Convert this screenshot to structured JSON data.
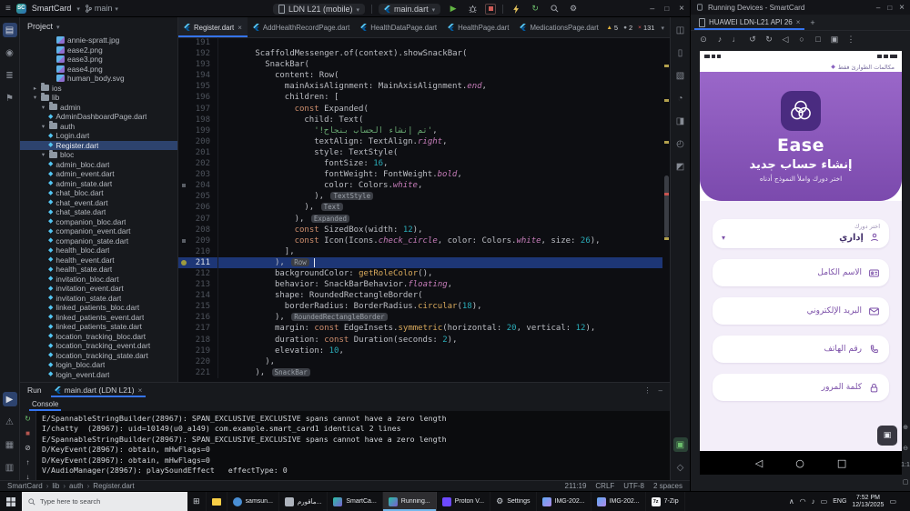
{
  "ide": {
    "titlebar": {
      "project_abbrev": "SC",
      "project_name": "SmartCard",
      "branch": "main",
      "device_selector": "LDN L21 (mobile)",
      "run_config": "main.dart"
    },
    "left_strip": [
      "project",
      "commit",
      "structure",
      "bookmarks"
    ],
    "left_strip_bottom": [
      "run",
      "problems",
      "terminal",
      "services"
    ],
    "left_strip_active": "project",
    "right_strip": [
      "notifications",
      "device-manager",
      "gradle",
      "ai",
      "build",
      "profiler",
      "emulator"
    ],
    "right_strip_bottom": [
      "running-devices",
      "gemini"
    ],
    "right_strip_active": "running-devices",
    "project": {
      "header": "Project",
      "items": [
        {
          "label": "annie-spratt.jpg",
          "icon": "image",
          "ind": 4
        },
        {
          "label": "ease2.png",
          "icon": "image",
          "ind": 4
        },
        {
          "label": "ease3.png",
          "icon": "image",
          "ind": 4
        },
        {
          "label": "ease4.png",
          "icon": "image",
          "ind": 4
        },
        {
          "label": "human_body.svg",
          "icon": "image",
          "ind": 4
        },
        {
          "label": "ios",
          "icon": "folder",
          "ind": 1,
          "chev": "closed"
        },
        {
          "label": "lib",
          "icon": "folder",
          "ind": 1,
          "chev": "open"
        },
        {
          "label": "admin",
          "icon": "folder",
          "ind": 2,
          "chev": "open"
        },
        {
          "label": "AdminDashboardPage.dart",
          "icon": "dart",
          "ind": 3
        },
        {
          "label": "auth",
          "icon": "folder",
          "ind": 2,
          "chev": "open"
        },
        {
          "label": "Login.dart",
          "icon": "dart",
          "ind": 3
        },
        {
          "label": "Register.dart",
          "icon": "dart",
          "ind": 3,
          "selected": true
        },
        {
          "label": "bloc",
          "icon": "folder",
          "ind": 2,
          "chev": "open"
        },
        {
          "label": "admin_bloc.dart",
          "icon": "dart",
          "ind": 3
        },
        {
          "label": "admin_event.dart",
          "icon": "dart",
          "ind": 3
        },
        {
          "label": "admin_state.dart",
          "icon": "dart",
          "ind": 3
        },
        {
          "label": "chat_bloc.dart",
          "icon": "dart",
          "ind": 3
        },
        {
          "label": "chat_event.dart",
          "icon": "dart",
          "ind": 3
        },
        {
          "label": "chat_state.dart",
          "icon": "dart",
          "ind": 3
        },
        {
          "label": "companion_bloc.dart",
          "icon": "dart",
          "ind": 3
        },
        {
          "label": "companion_event.dart",
          "icon": "dart",
          "ind": 3
        },
        {
          "label": "companion_state.dart",
          "icon": "dart",
          "ind": 3
        },
        {
          "label": "health_bloc.dart",
          "icon": "dart",
          "ind": 3
        },
        {
          "label": "health_event.dart",
          "icon": "dart",
          "ind": 3
        },
        {
          "label": "health_state.dart",
          "icon": "dart",
          "ind": 3
        },
        {
          "label": "invitation_bloc.dart",
          "icon": "dart",
          "ind": 3
        },
        {
          "label": "invitation_event.dart",
          "icon": "dart",
          "ind": 3
        },
        {
          "label": "invitation_state.dart",
          "icon": "dart",
          "ind": 3
        },
        {
          "label": "linked_patients_bloc.dart",
          "icon": "dart",
          "ind": 3
        },
        {
          "label": "linked_patients_event.dart",
          "icon": "dart",
          "ind": 3
        },
        {
          "label": "linked_patients_state.dart",
          "icon": "dart",
          "ind": 3
        },
        {
          "label": "location_tracking_bloc.dart",
          "icon": "dart",
          "ind": 3
        },
        {
          "label": "location_tracking_event.dart",
          "icon": "dart",
          "ind": 3
        },
        {
          "label": "location_tracking_state.dart",
          "icon": "dart",
          "ind": 3
        },
        {
          "label": "login_bloc.dart",
          "icon": "dart",
          "ind": 3
        },
        {
          "label": "login_event.dart",
          "icon": "dart",
          "ind": 3
        }
      ]
    },
    "editor": {
      "tabs": [
        {
          "label": "Register.dart",
          "active": true
        },
        {
          "label": "AddHealthRecordPage.dart"
        },
        {
          "label": "HealthDataPage.dart"
        },
        {
          "label": "HealthPage.dart"
        },
        {
          "label": "MedicationsPage.dart"
        }
      ],
      "inspections": [
        {
          "kind": "warning",
          "count": "5"
        },
        {
          "kind": "weak",
          "count": "2"
        },
        {
          "kind": "error",
          "count": "131"
        }
      ],
      "current_line": 211,
      "breakpoint_line": 211,
      "marker_lines": [
        204,
        209
      ],
      "lines": [
        {
          "n": 191,
          "i": 0,
          "s": []
        },
        {
          "n": 192,
          "i": 6,
          "s": [
            [
              "d",
              "ScaffoldMessenger.of(context).showSnackBar("
            ]
          ]
        },
        {
          "n": 193,
          "i": 8,
          "s": [
            [
              "d",
              "SnackBar("
            ]
          ]
        },
        {
          "n": 194,
          "i": 10,
          "s": [
            [
              "d",
              "content: Row("
            ]
          ]
        },
        {
          "n": 195,
          "i": 12,
          "s": [
            [
              "d",
              "mainAxisAlignment: MainAxisAlignment."
            ],
            [
              "m",
              "end"
            ],
            [
              "d",
              ","
            ]
          ]
        },
        {
          "n": 196,
          "i": 12,
          "s": [
            [
              "d",
              "children: ["
            ]
          ]
        },
        {
          "n": 197,
          "i": 14,
          "s": [
            [
              "k",
              "const "
            ],
            [
              "d",
              "Expanded("
            ]
          ]
        },
        {
          "n": 198,
          "i": 16,
          "s": [
            [
              "d",
              "child: Text("
            ]
          ]
        },
        {
          "n": 199,
          "i": 18,
          "s": [
            [
              "s",
              "'تم إنشاء الحساب بنجاح!'"
            ],
            [
              "d",
              ","
            ]
          ]
        },
        {
          "n": 200,
          "i": 18,
          "s": [
            [
              "d",
              "textAlign: TextAlign."
            ],
            [
              "m",
              "right"
            ],
            [
              "d",
              ","
            ]
          ]
        },
        {
          "n": 201,
          "i": 18,
          "s": [
            [
              "d",
              "style: TextStyle("
            ]
          ]
        },
        {
          "n": 202,
          "i": 20,
          "s": [
            [
              "d",
              "fontSize: "
            ],
            [
              "n",
              "16"
            ],
            [
              "d",
              ","
            ]
          ]
        },
        {
          "n": 203,
          "i": 20,
          "s": [
            [
              "d",
              "fontWeight: FontWeight."
            ],
            [
              "m",
              "bold"
            ],
            [
              "d",
              ","
            ]
          ]
        },
        {
          "n": 204,
          "i": 20,
          "s": [
            [
              "d",
              "color: Colors."
            ],
            [
              "m",
              "white"
            ],
            [
              "d",
              ","
            ]
          ]
        },
        {
          "n": 205,
          "i": 18,
          "s": [
            [
              "d",
              "), "
            ],
            [
              "h",
              "TextStyle"
            ]
          ]
        },
        {
          "n": 206,
          "i": 16,
          "s": [
            [
              "d",
              "), "
            ],
            [
              "h",
              "Text"
            ]
          ]
        },
        {
          "n": 207,
          "i": 14,
          "s": [
            [
              "d",
              "), "
            ],
            [
              "h",
              "Expanded"
            ]
          ]
        },
        {
          "n": 208,
          "i": 14,
          "s": [
            [
              "k",
              "const "
            ],
            [
              "d",
              "SizedBox(width: "
            ],
            [
              "n",
              "12"
            ],
            [
              "d",
              "),"
            ]
          ]
        },
        {
          "n": 209,
          "i": 14,
          "s": [
            [
              "k",
              "const "
            ],
            [
              "d",
              "Icon(Icons."
            ],
            [
              "m",
              "check_circle"
            ],
            [
              "d",
              ", color: Colors."
            ],
            [
              "m",
              "white"
            ],
            [
              "d",
              ", size: "
            ],
            [
              "n",
              "26"
            ],
            [
              "d",
              "),"
            ]
          ]
        },
        {
          "n": 210,
          "i": 12,
          "s": [
            [
              "d",
              "],"
            ]
          ]
        },
        {
          "n": 211,
          "i": 10,
          "s": [
            [
              "d",
              "), "
            ],
            [
              "h",
              "Row"
            ]
          ]
        },
        {
          "n": 212,
          "i": 10,
          "s": [
            [
              "d",
              "backgroundColor: "
            ],
            [
              "f",
              "getRoleColor"
            ],
            [
              "d",
              "(),"
            ]
          ]
        },
        {
          "n": 213,
          "i": 10,
          "s": [
            [
              "d",
              "behavior: SnackBarBehavior."
            ],
            [
              "m",
              "floating"
            ],
            [
              "d",
              ","
            ]
          ]
        },
        {
          "n": 214,
          "i": 10,
          "s": [
            [
              "d",
              "shape: RoundedRectangleBorder("
            ]
          ]
        },
        {
          "n": 215,
          "i": 12,
          "s": [
            [
              "d",
              "borderRadius: BorderRadius."
            ],
            [
              "f",
              "circular"
            ],
            [
              "d",
              "("
            ],
            [
              "n",
              "18"
            ],
            [
              "d",
              "),"
            ]
          ]
        },
        {
          "n": 216,
          "i": 10,
          "s": [
            [
              "d",
              "), "
            ],
            [
              "h",
              "RoundedRectangleBorder"
            ]
          ]
        },
        {
          "n": 217,
          "i": 10,
          "s": [
            [
              "d",
              "margin: "
            ],
            [
              "k",
              "const "
            ],
            [
              "d",
              "EdgeInsets."
            ],
            [
              "f",
              "symmetric"
            ],
            [
              "d",
              "(horizontal: "
            ],
            [
              "n",
              "20"
            ],
            [
              "d",
              ", vertical: "
            ],
            [
              "n",
              "12"
            ],
            [
              "d",
              "),"
            ]
          ]
        },
        {
          "n": 218,
          "i": 10,
          "s": [
            [
              "d",
              "duration: "
            ],
            [
              "k",
              "const "
            ],
            [
              "d",
              "Duration(seconds: "
            ],
            [
              "n",
              "2"
            ],
            [
              "d",
              "),"
            ]
          ]
        },
        {
          "n": 219,
          "i": 10,
          "s": [
            [
              "d",
              "elevation: "
            ],
            [
              "n",
              "10"
            ],
            [
              "d",
              ","
            ]
          ]
        },
        {
          "n": 220,
          "i": 8,
          "s": [
            [
              "d",
              "),"
            ]
          ]
        },
        {
          "n": 221,
          "i": 6,
          "s": [
            [
              "d",
              "), "
            ],
            [
              "h",
              "SnackBar"
            ]
          ]
        }
      ]
    },
    "run": {
      "title": "Run",
      "tab": "main.dart (LDN L21)",
      "console_label": "Console",
      "strip": [
        "rerun",
        "stop",
        "clear",
        "scroll-up",
        "scroll-down"
      ],
      "output": [
        "E/SpannableStringBuilder(28967): SPAN_EXCLUSIVE_EXCLUSIVE spans cannot have a zero length",
        "I/chatty  (28967): uid=10149(u0_a149) com.example.smart_card1 identical 2 lines",
        "E/SpannableStringBuilder(28967): SPAN_EXCLUSIVE_EXCLUSIVE spans cannot have a zero length",
        "D/KeyEvent(28967): obtain, mHwFlags=0",
        "D/KeyEvent(28967): obtain, mHwFlags=0",
        "V/AudioManager(28967): playSoundEffect   effectType: 0"
      ]
    },
    "status_bar": {
      "breadcrumbs": [
        "SmartCard",
        "lib",
        "auth",
        "Register.dart"
      ],
      "items": [
        "211:19",
        "CRLF",
        "UTF-8",
        "2 spaces"
      ]
    }
  },
  "devices": {
    "window_title": "Running Devices - SmartCard",
    "tab": "HUAWEI LDN-L21 API 26",
    "toolbar": [
      "power",
      "volume-up",
      "volume-down",
      "rotate-left",
      "rotate-right",
      "back",
      "home",
      "recents",
      "screenshot",
      "more"
    ],
    "zoom_icons": [
      "zoom-in",
      "zoom-out"
    ],
    "zoom_ratio": "1:1",
    "phone": {
      "emergency": "مكالمات الطوارئ فقط",
      "app_name": "Ease",
      "heading": "إنشاء حساب جديد",
      "subheading": "اختر دورك واملأ النموذج أدناه",
      "role_label": "اختر دورك",
      "role_value": "إداري",
      "fields": [
        {
          "label": "الاسم الكامل",
          "icon": "id-card"
        },
        {
          "label": "البريد الإلكتروني",
          "icon": "mail"
        },
        {
          "label": "رقم الهاتف",
          "icon": "phone"
        },
        {
          "label": "كلمة المرور",
          "icon": "lock"
        }
      ],
      "nav": [
        "back",
        "home",
        "recents"
      ]
    }
  },
  "taskbar": {
    "search_placeholder": "Type here to search",
    "buttons": [
      {
        "label": "",
        "icon": "task-view"
      },
      {
        "label": "",
        "icon": "explorer"
      },
      {
        "label": "samsun...",
        "icon": "app-blue"
      },
      {
        "label": "مأقورم...",
        "icon": "app-gray"
      },
      {
        "label": "SmartCa...",
        "icon": "android-studio"
      },
      {
        "label": "Running...",
        "icon": "android-studio",
        "active": true
      },
      {
        "label": "Proton V...",
        "icon": "proton"
      },
      {
        "label": "Settings",
        "icon": "gear"
      },
      {
        "label": "IMG-202...",
        "icon": "image"
      },
      {
        "label": "IMG-202...",
        "icon": "image"
      },
      {
        "label": "7-Zip",
        "icon": "7zip"
      }
    ],
    "tray": {
      "lang": "ENG",
      "time": "7:52 PM",
      "date": "12/13/2025"
    }
  }
}
